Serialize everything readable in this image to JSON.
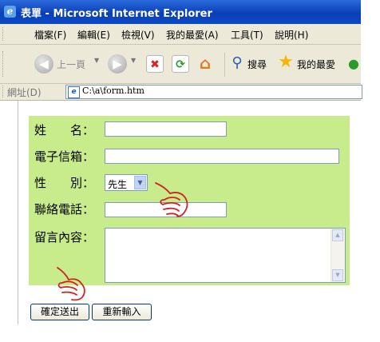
{
  "window": {
    "title": "表單 - Microsoft Internet Explorer"
  },
  "menu": [
    "檔案(F)",
    "編輯(E)",
    "檢視(V)",
    "我的最愛(A)",
    "工具(T)",
    "說明(H)"
  ],
  "toolbar": {
    "back_label": "上一頁",
    "search_label": "搜尋",
    "favorites_label": "我的最愛"
  },
  "address": {
    "label": "網址(D)",
    "url": "C:\\a\\form.htm"
  },
  "form": {
    "name_label": "姓　　名：",
    "email_label": "電子信箱：",
    "gender_label": "性　　別：",
    "gender_value": "先生",
    "phone_label": "聯絡電話：",
    "message_label": "留言內容："
  },
  "buttons": {
    "submit": "確定送出",
    "reset": "重新輸入"
  },
  "colors": {
    "form_background": "#c8ec8c",
    "titlebar": "#0a3fb8"
  },
  "icons": [
    "ie-logo-icon",
    "back-arrow-icon",
    "forward-arrow-icon",
    "stop-icon",
    "refresh-icon",
    "home-icon",
    "search-icon",
    "favorites-star-icon",
    "page-icon",
    "scroll-up-icon",
    "scroll-down-icon",
    "select-arrow-icon",
    "pointing-hand-icon"
  ]
}
